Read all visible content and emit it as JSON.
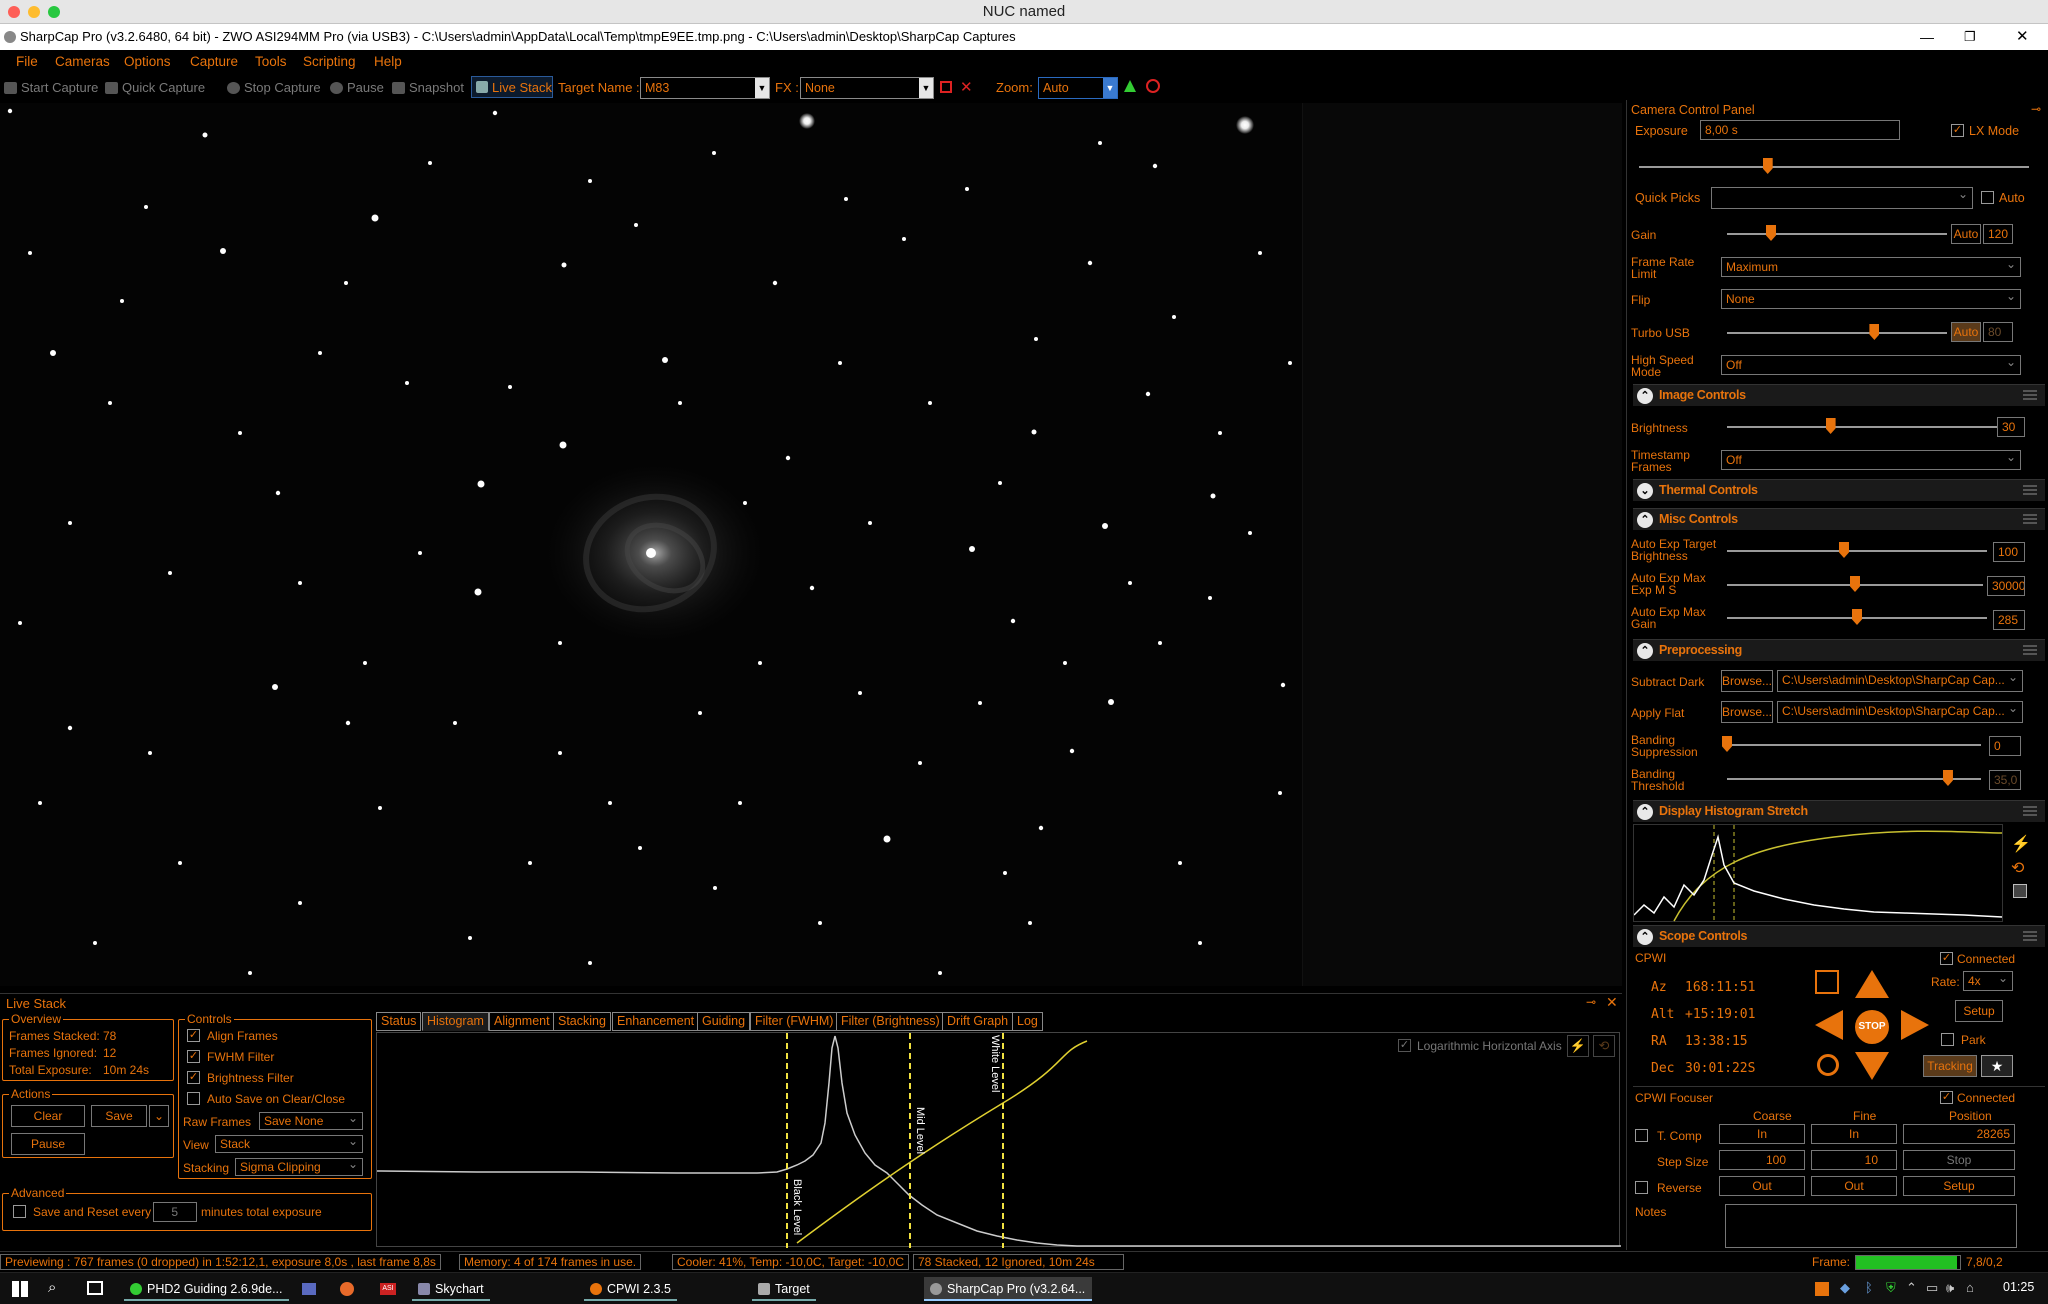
{
  "mac_title": "NUC named",
  "window_title": "SharpCap Pro (v3.2.6480, 64 bit) - ZWO ASI294MM Pro (via USB3) - C:\\Users\\admin\\AppData\\Local\\Temp\\tmpE9EE.tmp.png - C:\\Users\\admin\\Desktop\\SharpCap Captures",
  "menu": [
    "File",
    "Cameras",
    "Options",
    "Capture",
    "Tools",
    "Scripting",
    "Help"
  ],
  "toolbar": {
    "start_capture": "Start Capture",
    "quick_capture": "Quick Capture",
    "stop_capture": "Stop Capture",
    "pause": "Pause",
    "snapshot": "Snapshot",
    "live_stack": "Live Stack",
    "target_name_label": "Target Name :",
    "target_name_value": "M83",
    "fx_label": "FX :",
    "fx_value": "None",
    "zoom_label": "Zoom:",
    "zoom_value": "Auto"
  },
  "camera_panel": {
    "title": "Camera Control Panel",
    "exposure_label": "Exposure",
    "exposure_value": "8,00 s",
    "lx_mode": "LX Mode",
    "exposure_level": 0.33,
    "quick_picks_label": "Quick Picks",
    "auto_label": "Auto",
    "gain_label": "Gain",
    "gain_auto": "Auto",
    "gain_value": "120",
    "gain_level": 0.2,
    "frame_rate_label": "Frame Rate Limit",
    "frame_rate_value": "Maximum",
    "flip_label": "Flip",
    "flip_value": "None",
    "turbo_label": "Turbo USB",
    "turbo_auto": "Auto",
    "turbo_value": "80",
    "turbo_level": 0.67,
    "high_speed_label": "High Speed Mode",
    "high_speed_value": "Off"
  },
  "image_controls": {
    "title": "Image Controls",
    "brightness_label": "Brightness",
    "brightness_value": "30",
    "brightness_level": 0.37,
    "timestamp_label": "Timestamp Frames",
    "timestamp_value": "Off"
  },
  "thermal_controls": {
    "title": "Thermal Controls"
  },
  "misc_controls": {
    "title": "Misc Controls",
    "aetb_label": "Auto Exp Target Brightness",
    "aetb_value": "100",
    "aetb_level": 0.45,
    "aemax_label": "Auto Exp Max Exp M S",
    "aemax_value": "30000",
    "aemax_level": 0.5,
    "aegain_label": "Auto Exp Max Gain",
    "aegain_value": "285",
    "aegain_level": 0.5
  },
  "preprocessing": {
    "title": "Preprocessing",
    "dark_label": "Subtract Dark",
    "flat_label": "Apply Flat",
    "browse": "Browse...",
    "dark_path": "C:\\Users\\admin\\Desktop\\SharpCap Cap...",
    "flat_path": "C:\\Users\\admin\\Desktop\\SharpCap Cap...",
    "banding_sup_label": "Banding Suppression",
    "banding_sup_value": "0",
    "banding_sup_level": 0.0,
    "banding_thr_label": "Banding Threshold",
    "banding_thr_value": "35,0",
    "banding_thr_level": 0.87
  },
  "display_histogram": {
    "title": "Display Histogram Stretch"
  },
  "scope_controls": {
    "title": "Scope Controls",
    "mount": "CPWI",
    "connected": "Connected",
    "az_label": "Az",
    "az_value": "168:11:51",
    "alt_label": "Alt",
    "alt_value": "+15:19:01",
    "ra_label": "RA",
    "ra_value": "13:38:15",
    "dec_label": "Dec",
    "dec_value": "30:01:22S",
    "rate_label": "Rate:",
    "rate_value": "4x",
    "setup": "Setup",
    "park": "Park",
    "stop": "STOP",
    "tracking": "Tracking"
  },
  "focuser": {
    "title": "CPWI Focuser",
    "connected": "Connected",
    "coarse": "Coarse",
    "fine": "Fine",
    "position": "Position",
    "tcomp": "T. Comp",
    "in": "In",
    "position_value": "28265",
    "step_size_label": "Step Size",
    "coarse_step": "100",
    "fine_step": "10",
    "stop": "Stop",
    "reverse": "Reverse",
    "out": "Out",
    "setup": "Setup"
  },
  "notes_label": "Notes",
  "live_stack": {
    "title": "Live Stack",
    "overview_title": "Overview",
    "frames_stacked_label": "Frames Stacked:",
    "frames_stacked": "78",
    "frames_ignored_label": "Frames Ignored:",
    "frames_ignored": "12",
    "total_exposure_label": "Total Exposure:",
    "total_exposure": "10m 24s",
    "actions_title": "Actions",
    "clear": "Clear",
    "save": "Save",
    "pause": "Pause",
    "advanced_title": "Advanced",
    "save_reset_label": "Save and Reset every",
    "save_reset_value": "5",
    "minutes_label": "minutes total exposure",
    "controls_title": "Controls",
    "align_frames": "Align Frames",
    "fwhm_filter": "FWHM Filter",
    "brightness_filter": "Brightness Filter",
    "auto_save": "Auto Save on Clear/Close",
    "raw_frames_label": "Raw Frames",
    "raw_frames_value": "Save None",
    "view_label": "View",
    "view_value": "Stack",
    "stacking_label": "Stacking",
    "stacking_value": "Sigma Clipping",
    "tabs": [
      "Status",
      "Histogram",
      "Alignment",
      "Stacking",
      "Enhancement",
      "Guiding",
      "Filter (FWHM)",
      "Filter (Brightness)",
      "Drift Graph",
      "Log"
    ],
    "log_axis": "Logarithmic Horizontal Axis",
    "black_level": "Black Level",
    "mid_level": "Mid Level",
    "white_level": "White Level"
  },
  "status": {
    "previewing": "Previewing : 767 frames (0 dropped) in 1:52:12,1, exposure 8,0s , last frame 8,8s",
    "memory": "Memory: 4 of 174 frames in use.",
    "cooler": "Cooler: 41%, Temp: -10,0C, Target: -10,0C",
    "stacked": "78 Stacked, 12 Ignored, 10m 24s",
    "frame_label": "Frame:",
    "frame_value": "7,8/0,2",
    "frame_progress": 0.97
  },
  "taskbar": {
    "items": [
      "PHD2 Guiding 2.6.9de...",
      "Skychart",
      "CPWI 2.3.5",
      "Target",
      "SharpCap Pro (v3.2.64..."
    ],
    "clock": "01:25"
  },
  "colors": {
    "accent": "#e8730c",
    "highlight": "#f0e040",
    "green": "#22c022"
  }
}
